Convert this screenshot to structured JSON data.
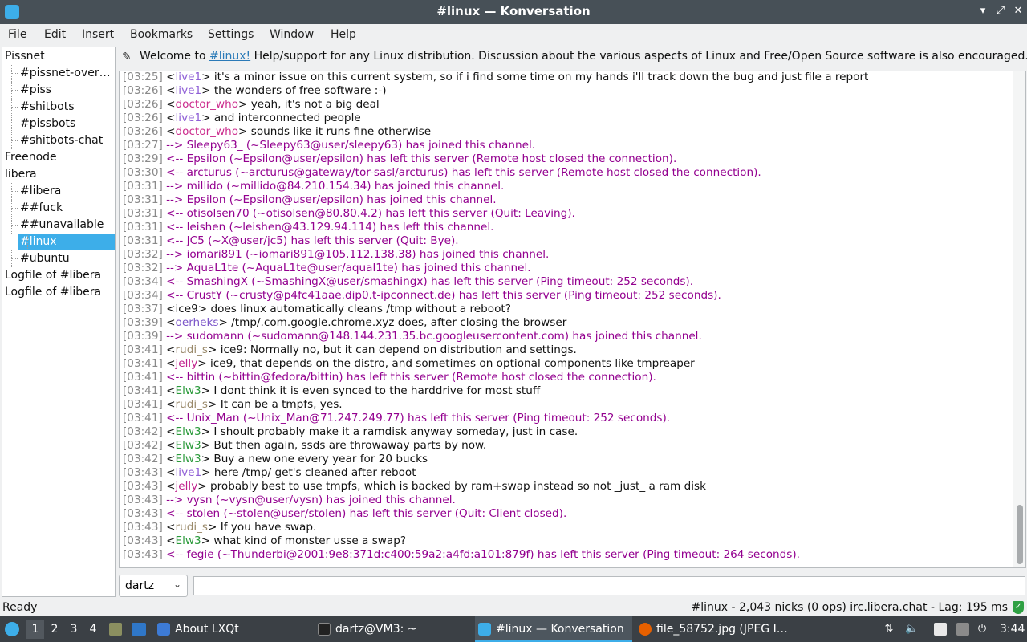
{
  "window": {
    "title": "#linux — Konversation"
  },
  "menu": [
    "File",
    "Edit",
    "Insert",
    "Bookmarks",
    "Settings",
    "Window",
    "Help"
  ],
  "tree": [
    {
      "label": "Pissnet",
      "level": 0
    },
    {
      "label": "#pissnet-over…",
      "level": 1
    },
    {
      "label": "#piss",
      "level": 1
    },
    {
      "label": "#shitbots",
      "level": 1
    },
    {
      "label": "#pissbots",
      "level": 1
    },
    {
      "label": "#shitbots-chat",
      "level": 1
    },
    {
      "label": "Freenode",
      "level": 0
    },
    {
      "label": "libera",
      "level": 0
    },
    {
      "label": "#libera",
      "level": 1
    },
    {
      "label": "##fuck",
      "level": 1
    },
    {
      "label": "##unavailable",
      "level": 1
    },
    {
      "label": "#linux",
      "level": 1,
      "selected": true
    },
    {
      "label": "#ubuntu",
      "level": 1
    },
    {
      "label": "Logfile of #libera",
      "level": 0
    },
    {
      "label": "Logfile of #libera",
      "level": 0
    }
  ],
  "topic": {
    "prefix": "Welcome to ",
    "link": "#linux!",
    "rest": " Help/support for any Linux distribution. Discussion about the various aspects of Linux and Free/Open Source software is also encouraged. ..."
  },
  "colors": {
    "event": "#93008f",
    "live1": "#8f5fd6",
    "doctor_who": "#cc2e8e",
    "ice9": "#111111",
    "oerheks": "#7c56c9",
    "rudi_s": "#9a8a6b",
    "jelly": "#c0208c",
    "Elw3": "#2a9a3a",
    "selection": "#3daee9"
  },
  "messages": [
    {
      "time": "[03:25]",
      "nick": "live1",
      "text": " it's a minor issue on this current system, so if i find some time on my hands i'll track down the bug and just file a report"
    },
    {
      "time": "[03:26]",
      "nick": "live1",
      "text": " the wonders of free software :-)"
    },
    {
      "time": "[03:26]",
      "nick": "doctor_who",
      "text": " yeah, it's not a big deal"
    },
    {
      "time": "[03:26]",
      "nick": "live1",
      "text": " and interconnected people"
    },
    {
      "time": "[03:26]",
      "nick": "doctor_who",
      "text": " sounds like it runs fine otherwise"
    },
    {
      "time": "[03:27]",
      "event": "--> Sleepy63_ (~Sleepy63@user/sleepy63) has joined this channel."
    },
    {
      "time": "[03:29]",
      "event": "<-- Epsilon (~Epsilon@user/epsilon) has left this server (Remote host closed the connection)."
    },
    {
      "time": "[03:30]",
      "event": "<-- arcturus (~arcturus@gateway/tor-sasl/arcturus) has left this server (Remote host closed the connection)."
    },
    {
      "time": "[03:31]",
      "event": "--> millido (~millido@84.210.154.34) has joined this channel."
    },
    {
      "time": "[03:31]",
      "event": "--> Epsilon (~Epsilon@user/epsilon) has joined this channel."
    },
    {
      "time": "[03:31]",
      "event": "<-- otisolsen70 (~otisolsen@80.80.4.2) has left this server (Quit: Leaving)."
    },
    {
      "time": "[03:31]",
      "event": "<-- leishen (~leishen@43.129.94.114) has left this channel."
    },
    {
      "time": "[03:31]",
      "event": "<-- JC5 (~X@user/jc5) has left this server (Quit: Bye)."
    },
    {
      "time": "[03:32]",
      "event": "--> iomari891 (~iomari891@105.112.138.38) has joined this channel."
    },
    {
      "time": "[03:32]",
      "event": "--> AquaL1te (~AquaL1te@user/aqual1te) has joined this channel."
    },
    {
      "time": "[03:34]",
      "event": "<-- SmashingX (~SmashingX@user/smashingx) has left this server (Ping timeout: 252 seconds)."
    },
    {
      "time": "[03:34]",
      "event": "<-- CrustY (~crusty@p4fc41aae.dip0.t-ipconnect.de) has left this server (Ping timeout: 252 seconds)."
    },
    {
      "time": "[03:37]",
      "nick": "ice9",
      "text": " does linux automatically cleans /tmp without a reboot?"
    },
    {
      "time": "[03:39]",
      "nick": "oerheks",
      "text": "  /tmp/.com.google.chrome.xyz does, after closing the browser"
    },
    {
      "time": "[03:39]",
      "event": "--> sudomann (~sudomann@148.144.231.35.bc.googleusercontent.com) has joined this channel."
    },
    {
      "time": "[03:41]",
      "nick": "rudi_s",
      "text": " ice9: Normally no, but it can depend on distribution and settings."
    },
    {
      "time": "[03:41]",
      "nick": "jelly",
      "text": " ice9, that depends on the distro, and sometimes on optional components like tmpreaper"
    },
    {
      "time": "[03:41]",
      "event": "<-- bittin (~bittin@fedora/bittin) has left this server (Remote host closed the connection)."
    },
    {
      "time": "[03:41]",
      "nick": "Elw3",
      "text": " I dont think it is even synced to the harddrive for most stuff"
    },
    {
      "time": "[03:41]",
      "nick": "rudi_s",
      "text": " It can be a tmpfs, yes."
    },
    {
      "time": "[03:41]",
      "event": "<-- Unix_Man (~Unix_Man@71.247.249.77) has left this server (Ping timeout: 252 seconds)."
    },
    {
      "time": "[03:42]",
      "nick": "Elw3",
      "text": " I shoult probably make it a ramdisk anyway someday, just in case."
    },
    {
      "time": "[03:42]",
      "nick": "Elw3",
      "text": " But then again, ssds are throwaway parts by now."
    },
    {
      "time": "[03:42]",
      "nick": "Elw3",
      "text": " Buy a new one every year for 20 bucks"
    },
    {
      "time": "[03:43]",
      "nick": "live1",
      "text": " here /tmp/ get's cleaned after reboot"
    },
    {
      "time": "[03:43]",
      "nick": "jelly",
      "text": " probably best to use tmpfs, which is backed by ram+swap instead so not _just_ a ram disk"
    },
    {
      "time": "[03:43]",
      "event": "--> vysn (~vysn@user/vysn) has joined this channel."
    },
    {
      "time": "[03:43]",
      "event": "<-- stolen (~stolen@user/stolen) has left this server (Quit: Client closed)."
    },
    {
      "time": "[03:43]",
      "nick": "rudi_s",
      "text": " If you have swap."
    },
    {
      "time": "[03:43]",
      "nick": "Elw3",
      "text": " what kind of monster usse a swap?"
    },
    {
      "time": "[03:43]",
      "event": "<-- fegie (~Thunderbi@2001:9e8:371d:c400:59a2:a4fd:a101:879f) has left this server (Ping timeout: 264 seconds)."
    }
  ],
  "input": {
    "nick": "dartz",
    "value": ""
  },
  "status": {
    "left": "Ready",
    "right": "#linux - 2,043 nicks (0 ops)  irc.libera.chat - Lag: 195 ms"
  },
  "taskbar": {
    "desktops": [
      "1",
      "2",
      "3",
      "4"
    ],
    "tasks": [
      {
        "label": "About LXQt",
        "icon": "lxqt-icon"
      },
      {
        "label": "dartz@VM3: ~",
        "icon": "terminal-icon"
      },
      {
        "label": "#linux — Konversation",
        "icon": "konversation-icon",
        "active": true
      },
      {
        "label": "file_58752.jpg (JPEG I…",
        "icon": "firefox-icon"
      }
    ],
    "clock": "3:44"
  }
}
